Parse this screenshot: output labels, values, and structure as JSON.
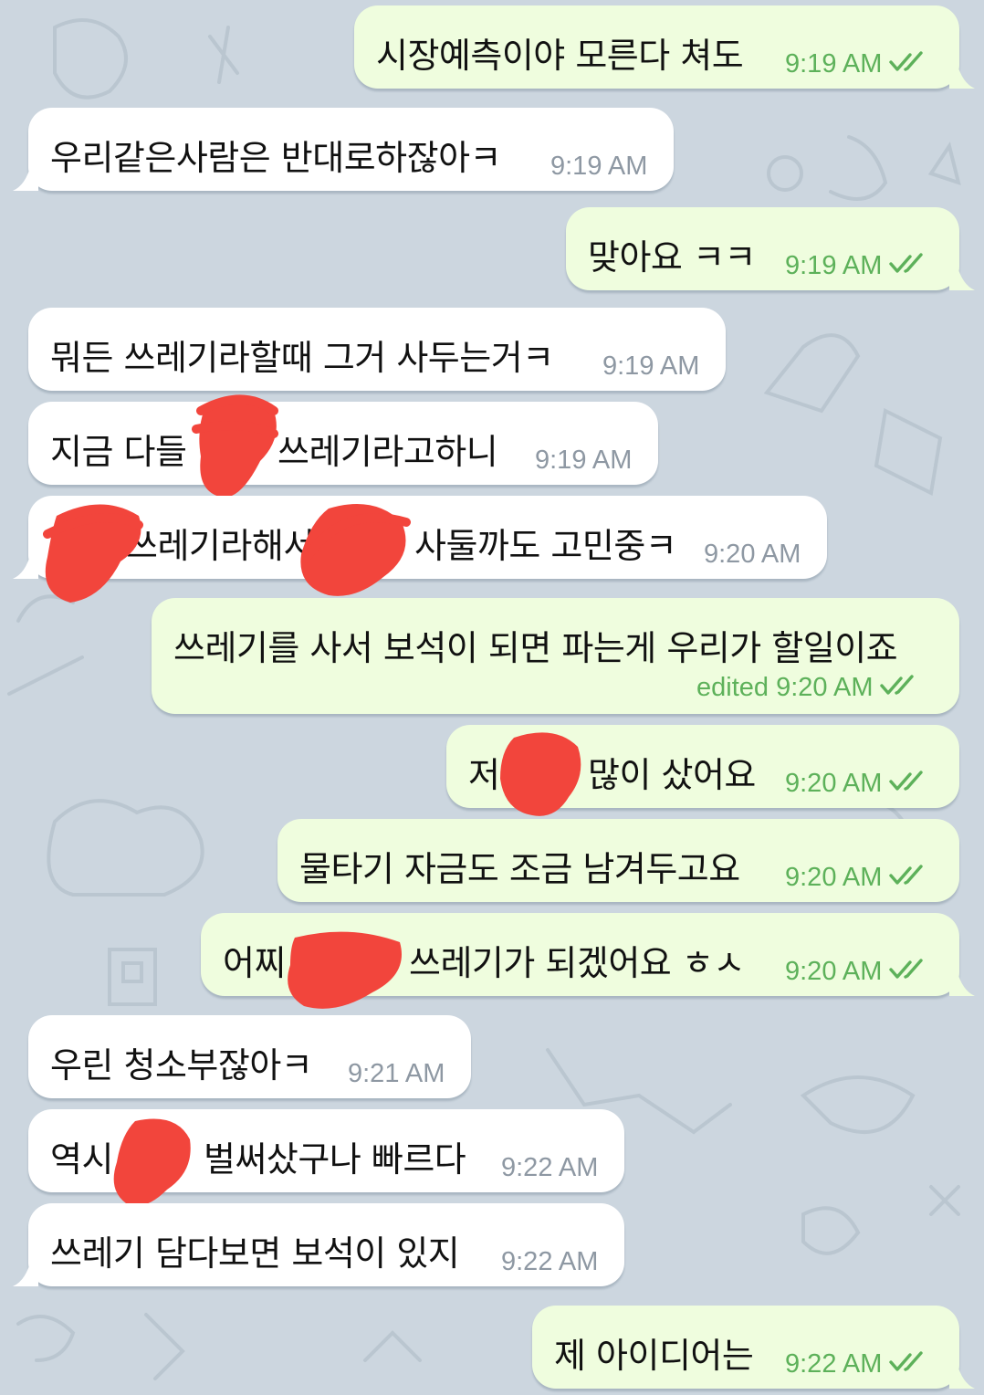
{
  "chat": {
    "colors": {
      "background": "#ccd6df",
      "incoming_bubble": "#ffffff",
      "outgoing_bubble": "#effdde",
      "outgoing_time": "#5db15a",
      "incoming_time": "#8e98a3",
      "redaction": "#f2453c"
    },
    "messages": [
      {
        "dir": "out",
        "text": "시장예측이야 모른다 쳐도",
        "time": "9:19 AM",
        "read": true
      },
      {
        "dir": "in",
        "text": "우리같은사람은 반대로하잖아ㅋ",
        "time": "9:19 AM"
      },
      {
        "dir": "out",
        "text": "맞아요 ㅋㅋ",
        "time": "9:19 AM",
        "read": true
      },
      {
        "dir": "in",
        "text": "뭐든 쓰레기라할때 그거 사두는거ㅋ",
        "time": "9:19 AM"
      },
      {
        "dir": "in",
        "text_a": "지금 다들",
        "text_b": "쓰레기라고하니",
        "time": "9:19 AM"
      },
      {
        "dir": "in",
        "text_a": "쓰레기라해서",
        "text_b": "사둘까도 고민중ㅋ",
        "time": "9:20 AM"
      },
      {
        "dir": "out",
        "text": "쓰레기를 사서 보석이 되면 파는게 우리가 할일이죠",
        "edited_label": "edited",
        "time": "9:20 AM",
        "read": true
      },
      {
        "dir": "out",
        "text_a": "저",
        "text_b": "많이 샀어요",
        "time": "9:20 AM",
        "read": true
      },
      {
        "dir": "out",
        "text": "물타기 자금도 조금 남겨두고요",
        "time": "9:20 AM",
        "read": true
      },
      {
        "dir": "out",
        "text_a": "어찌",
        "text_b": "쓰레기가 되겠어요 ㅎㅅ",
        "time": "9:20 AM",
        "read": true
      },
      {
        "dir": "in",
        "text": "우린 청소부잖아ㅋ",
        "time": "9:21 AM"
      },
      {
        "dir": "in",
        "text_a": "역시",
        "text_b": "벌써샀구나 빠르다",
        "time": "9:22 AM"
      },
      {
        "dir": "in",
        "text": "쓰레기 담다보면 보석이 있지",
        "time": "9:22 AM"
      },
      {
        "dir": "out",
        "text": "제 아이디어는",
        "time": "9:22 AM",
        "read": true
      }
    ]
  }
}
